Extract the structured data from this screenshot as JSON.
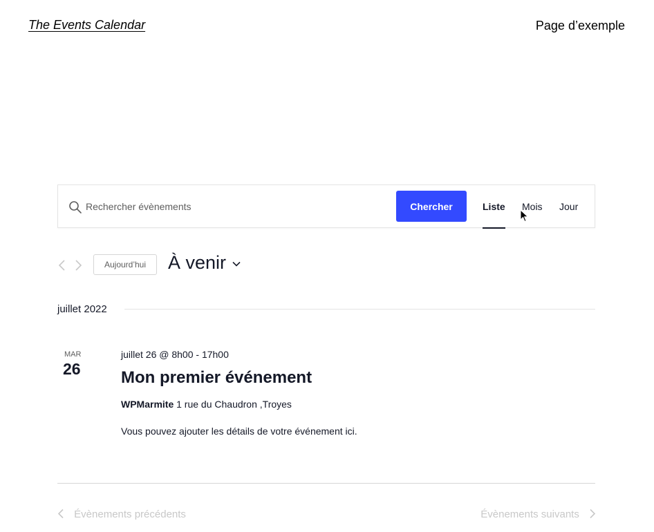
{
  "header": {
    "site_title": "The Events Calendar",
    "page_link": "Page d’exemple"
  },
  "search": {
    "placeholder": "Rechercher évènements",
    "value": "",
    "button_label": "Chercher"
  },
  "views": [
    {
      "label": "Liste",
      "active": true
    },
    {
      "label": "Mois",
      "active": false
    },
    {
      "label": "Jour",
      "active": false
    }
  ],
  "nav": {
    "today_label": "Aujourd’hui",
    "datepicker_label": "À venir"
  },
  "month_separator": "juillet 2022",
  "event": {
    "weekday": "MAR",
    "day": "26",
    "datetime": "juillet 26 @ 8h00 - 17h00",
    "title": "Mon premier événement",
    "venue_name": "WPMarmite",
    "venue_address": "1 rue du Chaudron ,Troyes",
    "description": "Vous pouvez ajouter les détails de votre événement ici."
  },
  "footer": {
    "prev_label": "Évènements précédents",
    "next_label": "Évènements suivants"
  },
  "colors": {
    "accent": "#334aff",
    "text": "#141827",
    "muted": "#5d5d5d",
    "disabled": "#c8c8c8",
    "border": "#e4e4e4"
  },
  "icons": {
    "search": "search-icon",
    "prev": "chevron-left-icon",
    "next": "chevron-right-icon",
    "datepicker": "chevron-down-icon",
    "cursor": "mouse-pointer-icon"
  }
}
